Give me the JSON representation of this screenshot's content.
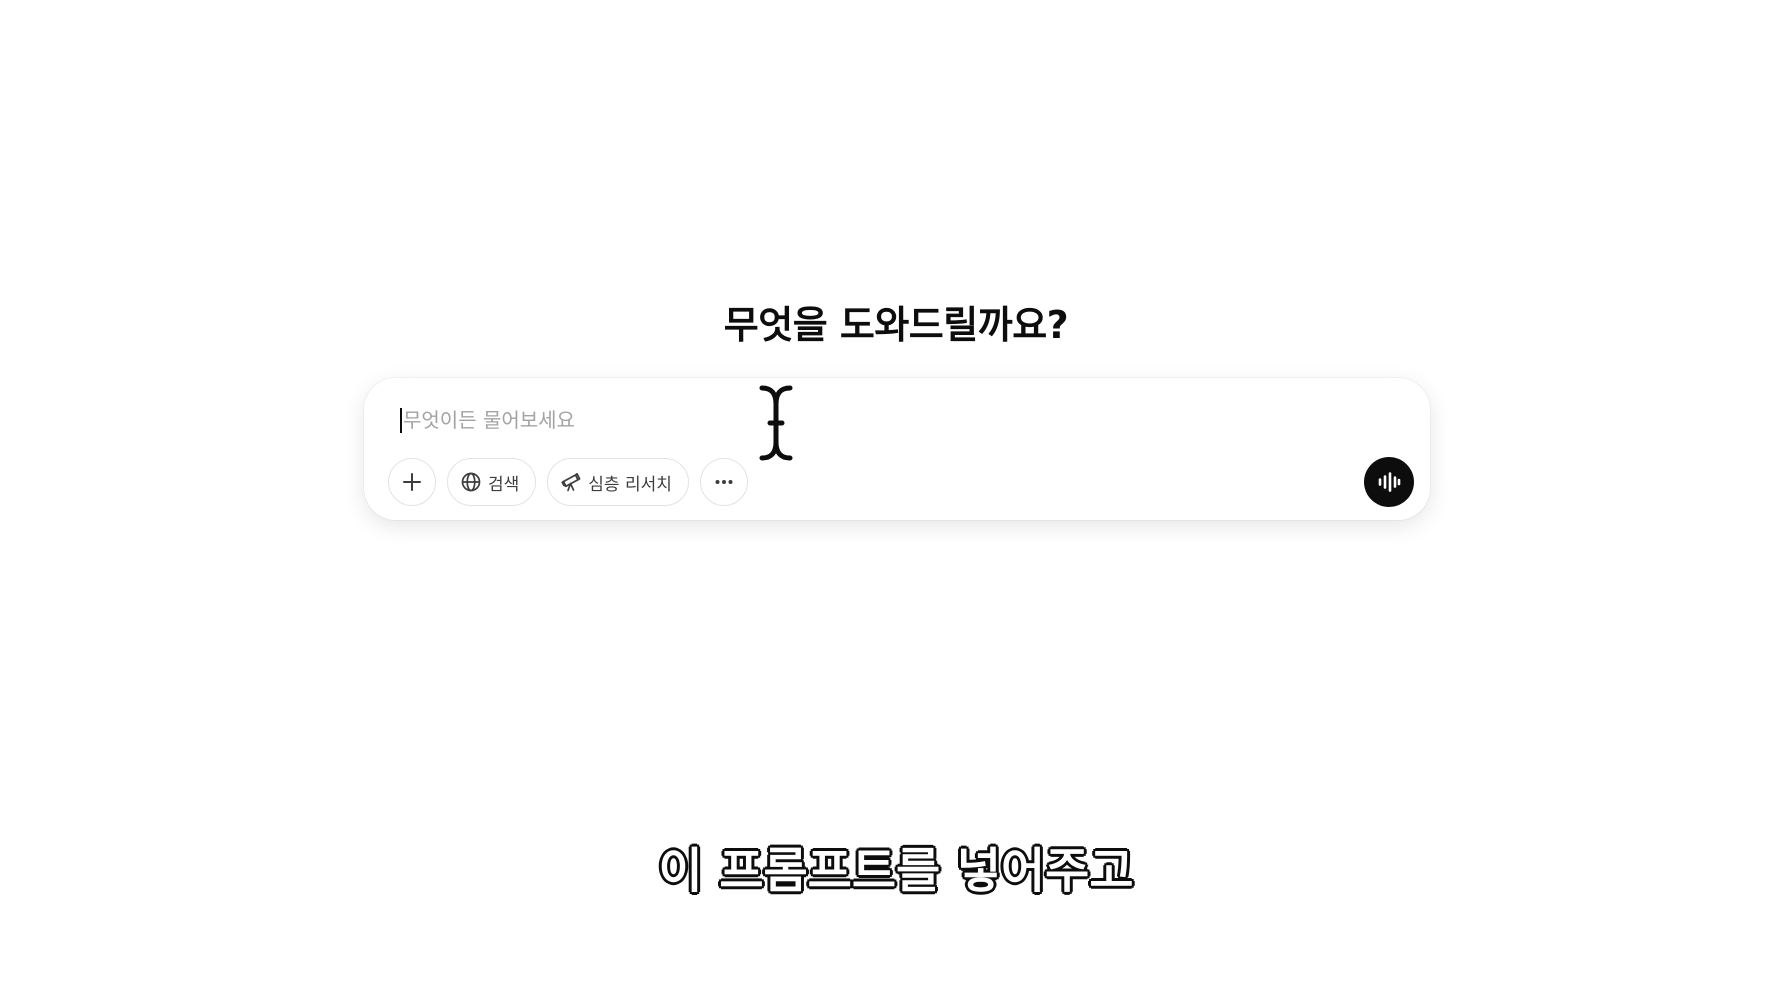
{
  "heading": {
    "text": "무엇을 도와드릴까요?"
  },
  "composer": {
    "placeholder": "무엇이든 물어보세요",
    "value": "",
    "tools": {
      "add_icon": "plus-icon",
      "search_label": "검색",
      "search_icon": "globe-icon",
      "deep_research_label": "심층 리서치",
      "deep_research_icon": "telescope-icon",
      "more_icon": "ellipsis-icon"
    },
    "voice_icon": "voice-waveform-icon"
  },
  "subtitle": {
    "text": "이 프롬프트를 넣어주고"
  },
  "colors": {
    "background": "#ffffff",
    "text": "#0d0d0d",
    "placeholder": "#a3a3a3",
    "border": "#e3e3e3",
    "voice_button": "#0d0d0d"
  }
}
